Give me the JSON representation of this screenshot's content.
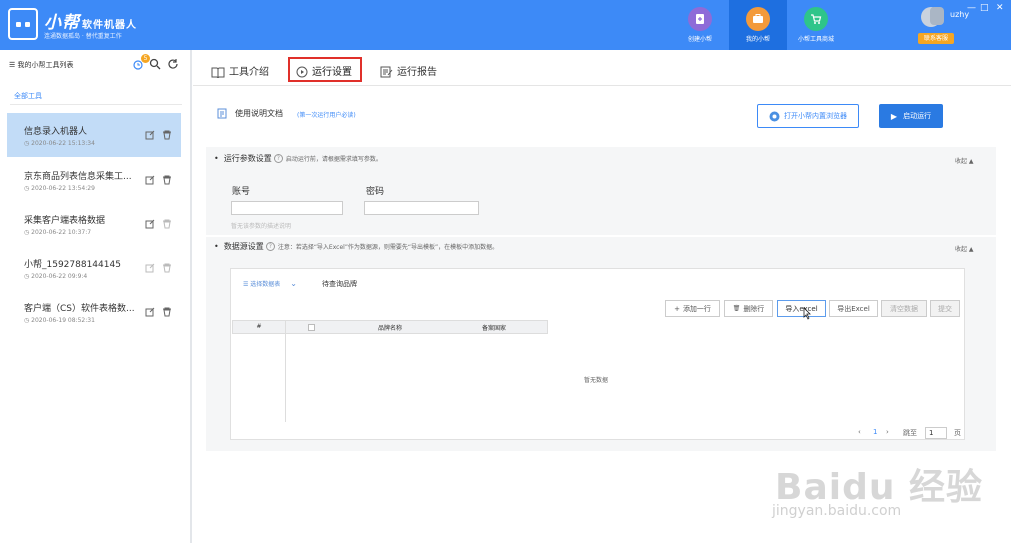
{
  "app": {
    "title": "小帮",
    "title_suffix": "软件机器人",
    "subtitle": "连通数据孤岛 · 替代重复工作"
  },
  "topnav": {
    "items": [
      {
        "label": "创建小帮",
        "color": "#8e6bd8",
        "icon": "document-plus-icon",
        "active": false
      },
      {
        "label": "我的小帮",
        "color": "#f39a3a",
        "icon": "toolbox-icon",
        "active": true
      },
      {
        "label": "小帮工具商城",
        "color": "#2ec58a",
        "icon": "cart-icon",
        "active": false
      }
    ],
    "username": "uzhy",
    "badge": "联系客服",
    "window_controls": [
      "—",
      "□",
      "✕"
    ]
  },
  "sidebar": {
    "header": "我的小帮工具列表",
    "notification_count": "5",
    "filter_label": "全部工具",
    "tools": [
      {
        "name": "信息录入机器人",
        "date": "2020-06-22 15:13:34",
        "active": true
      },
      {
        "name": "京东商品列表信息采集工...",
        "date": "2020-06-22 13:54:29",
        "active": false
      },
      {
        "name": "采集客户端表格数据",
        "date": "2020-06-22 10:37:7",
        "active": false
      },
      {
        "name": "小帮_1592788144145",
        "date": "2020-06-22 09:9:4",
        "active": false
      },
      {
        "name": "客户端（CS）软件表格数...",
        "date": "2020-06-19 08:52:31",
        "active": false
      }
    ]
  },
  "tabs": [
    {
      "label": "工具介绍",
      "icon": "book-icon"
    },
    {
      "label": "运行设置",
      "icon": "play-circle-icon"
    },
    {
      "label": "运行报告",
      "icon": "report-icon"
    }
  ],
  "doc": {
    "label": "使用说明文档",
    "note": "(第一次运行用户必读)",
    "browser_button": "打开小帮内置浏览器",
    "start_button": "启动运行"
  },
  "run_params": {
    "title": "运行参数设置",
    "hint": "启动运行前，请根据需求填写参数。",
    "collapse": "收起",
    "account_label": "账号",
    "password_label": "密码",
    "account_value": "",
    "password_value": "",
    "field_hint": "暂无该参数的描述说明"
  },
  "data_source": {
    "title": "数据源设置",
    "hint": "注意：若选择“导入Excel”作为数据源，则需要先“导出模板”，在模板中添加数据。",
    "collapse": "收起",
    "select_tab": "选择数据表",
    "query_tab": "待查询品牌",
    "toolbar": {
      "add_row": "添加一行",
      "delete_row": "删除行",
      "import_excel": "导入excel",
      "export_excel": "导出Excel",
      "clear_data": "清空数据",
      "submit": "提交"
    },
    "columns": [
      "#",
      "",
      "品牌名称",
      "备案国家"
    ],
    "empty_text": "暂无数据",
    "pager": {
      "current": "1",
      "goto_label": "跳至",
      "page_input": "1",
      "page_unit": "页"
    }
  },
  "watermark": {
    "brand": "Baidu 经验",
    "url": "jingyan.baidu.com"
  }
}
